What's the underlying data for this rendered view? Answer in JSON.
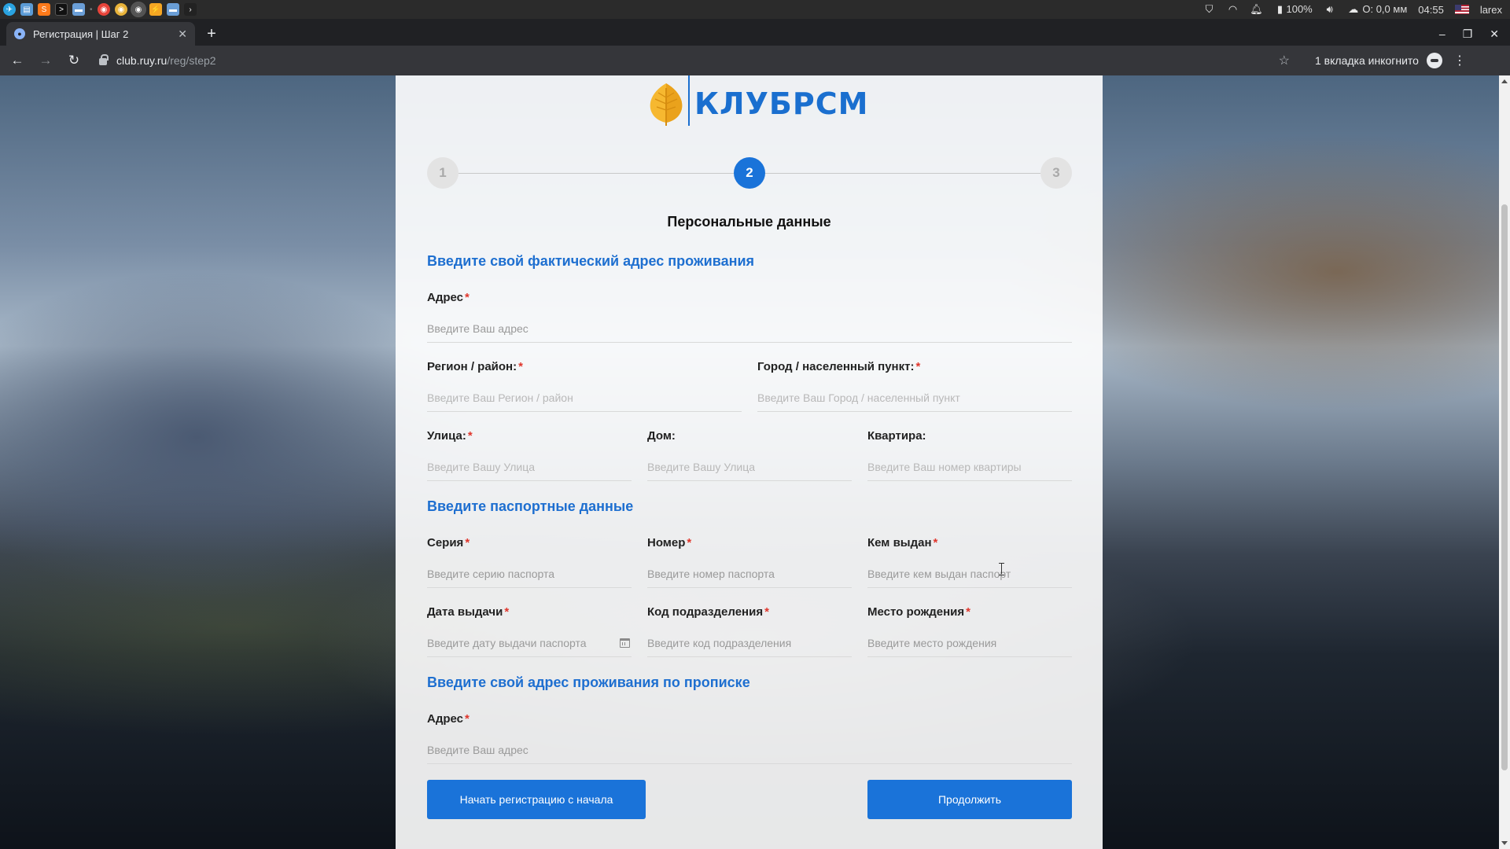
{
  "system_panel": {
    "apps": [
      "telegram-icon",
      "files-icon",
      "sublime-icon",
      "terminal-icon",
      "folder-icon",
      "chrome-icon",
      "chrome-icon",
      "chrome-incognito-icon",
      "sublime-text-icon",
      "folder-icon",
      "terminal-icon"
    ],
    "battery": "100%",
    "weather": "О: 0,0 мм",
    "time": "04:55",
    "user": "larex"
  },
  "browser": {
    "tab_title": "Регистрация | Шаг 2",
    "url_host": "club.ruy.ru",
    "url_path": "/reg/step2",
    "incognito_label": "1 вкладка инкогнито"
  },
  "page": {
    "logo_text": "КЛУБРСМ",
    "steps": [
      "1",
      "2",
      "3"
    ],
    "active_step": 2,
    "title": "Персональные данные",
    "actual_address": {
      "heading": "Введите свой фактический адрес проживания",
      "address_label": "Адрес",
      "address_placeholder": "Введите Ваш адрес",
      "region_label": "Регион / район:",
      "region_placeholder": "Введите Ваш Регион / район",
      "city_label": "Город / населенный пункт:",
      "city_placeholder": "Введите Ваш Город / населенный пункт",
      "street_label": "Улица:",
      "street_placeholder": "Введите Вашу Улица",
      "house_label": "Дом:",
      "house_placeholder": "Введите Вашу Улица",
      "apartment_label": "Квартира:",
      "apartment_placeholder": "Введите Ваш номер квартиры"
    },
    "passport": {
      "heading": "Введите паспортные данные",
      "series_label": "Серия",
      "series_placeholder": "Введите серию паспорта",
      "number_label": "Номер",
      "number_placeholder": "Введите номер паспорта",
      "issued_by_label": "Кем выдан",
      "issued_by_placeholder": "Введите кем выдан паспорт",
      "issue_date_label": "Дата выдачи",
      "issue_date_placeholder": "Введите дату выдачи паспорта",
      "division_code_label": "Код подразделения",
      "division_code_placeholder": "Введите код подразделения",
      "birthplace_label": "Место рождения",
      "birthplace_placeholder": "Введите место рождения"
    },
    "registration_address": {
      "heading": "Введите свой адрес проживания по прописке",
      "address_label": "Адрес",
      "address_placeholder": "Введите Ваш адрес"
    },
    "required_mark": "*",
    "restart_button": "Начать регистрацию с начала",
    "continue_button": "Продолжить"
  },
  "colors": {
    "accent": "#1a73d9",
    "heading_blue": "#1e6fd0",
    "required_red": "#e0362c"
  }
}
